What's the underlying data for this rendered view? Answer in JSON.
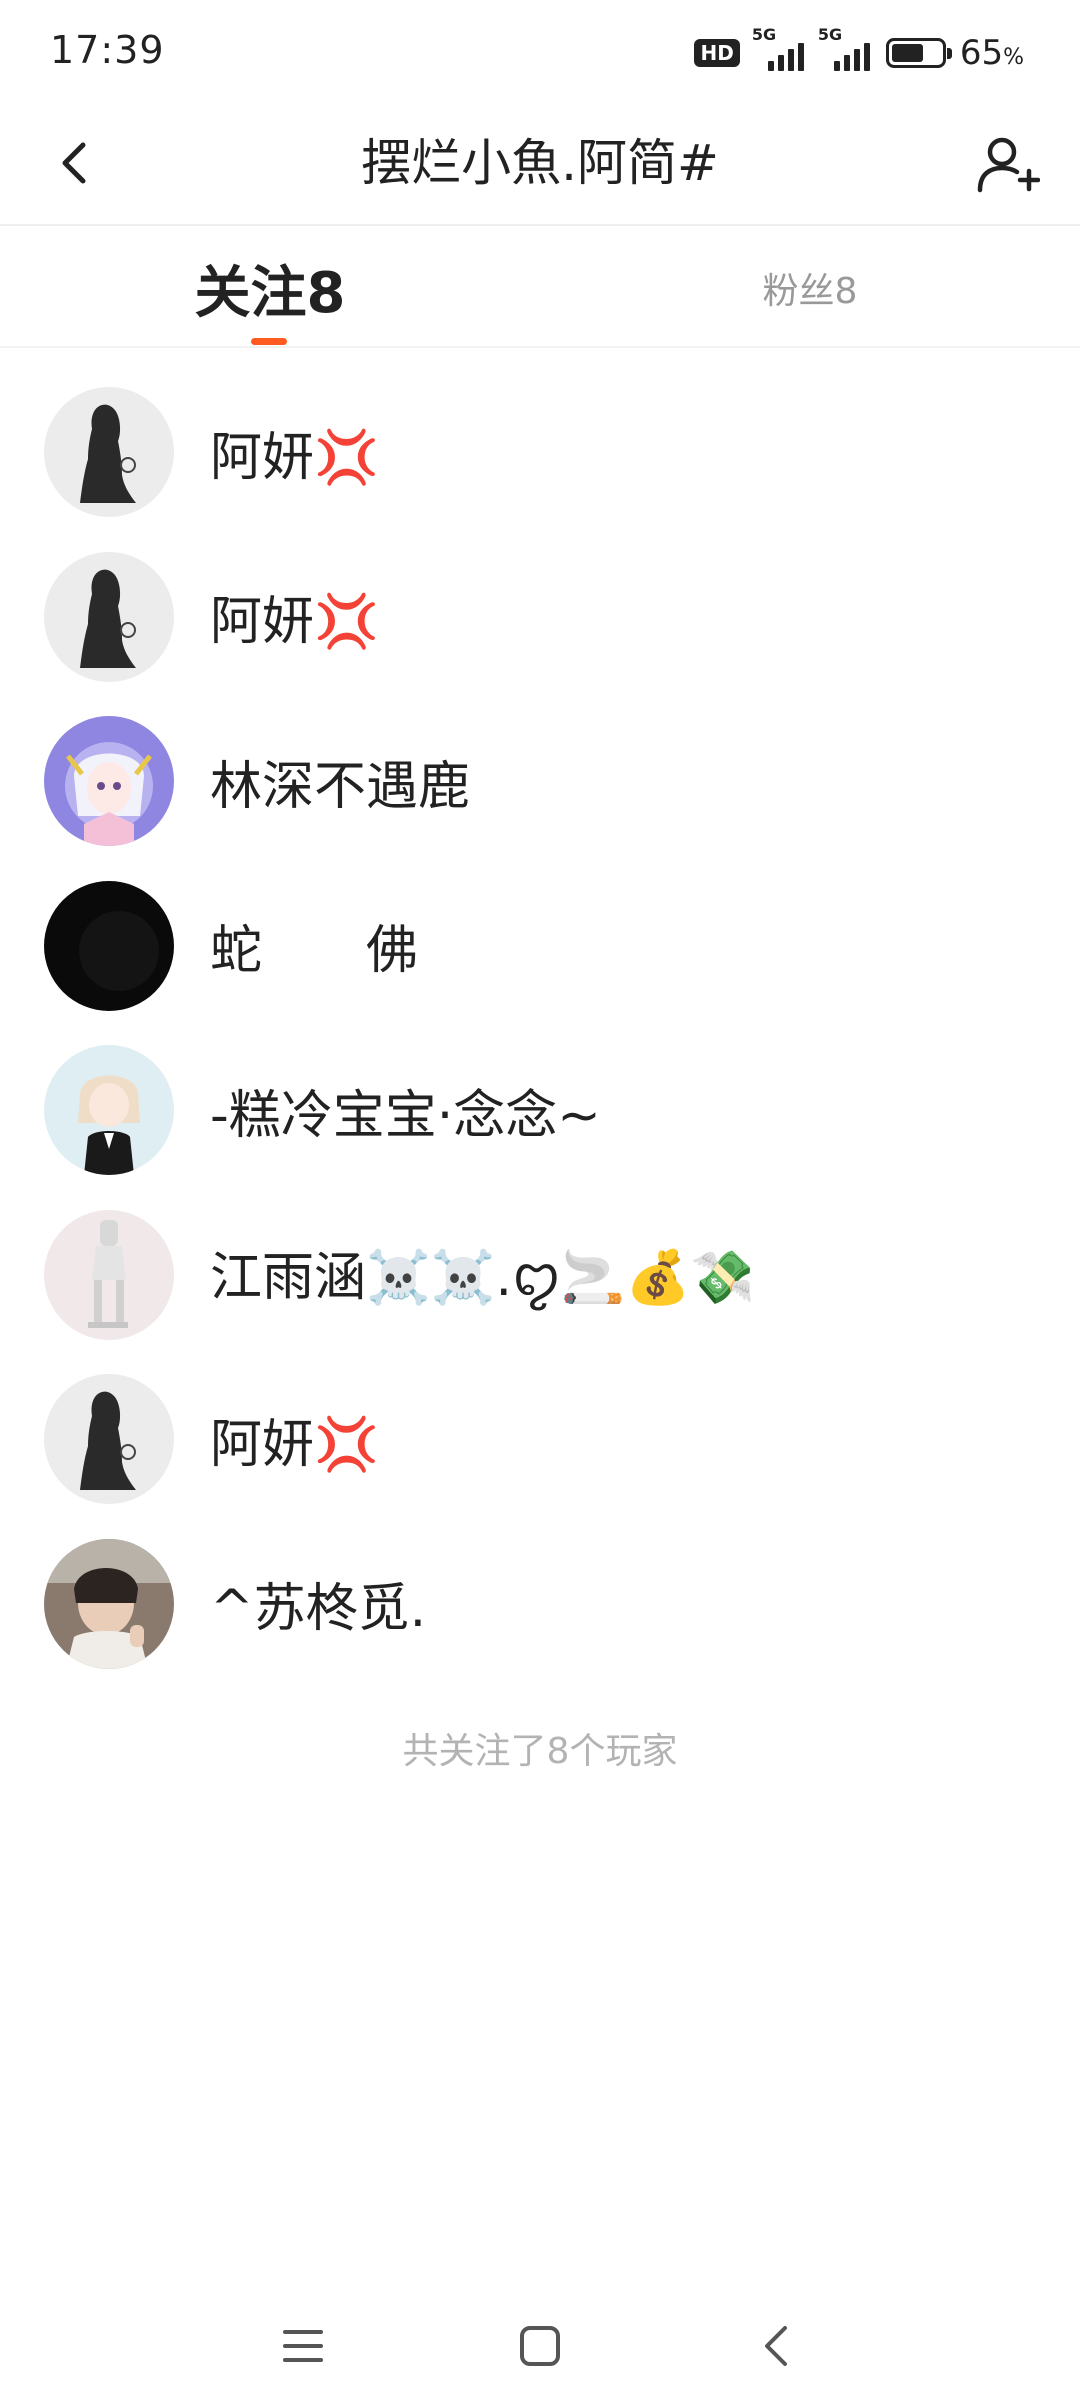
{
  "status_bar": {
    "time": "17:39",
    "hd_label": "HD",
    "signal_1_label": "5G",
    "signal_2_label": "5G",
    "battery_percent": 65,
    "battery_text": "65",
    "battery_unit": "%"
  },
  "header": {
    "title": "摆烂小魚.阿简#",
    "back_icon": "chevron-left-icon",
    "add_user_icon": "add-user-icon"
  },
  "tabs": [
    {
      "label": "关注8",
      "active": true
    },
    {
      "label": "粉丝8",
      "active": false
    }
  ],
  "accent_color": "#ff5a1f",
  "following": [
    {
      "name": "阿妍💢",
      "avatar": "silhouette-avatar"
    },
    {
      "name": "阿妍💢",
      "avatar": "silhouette-avatar"
    },
    {
      "name": "林深不遇鹿",
      "avatar": "anime-girl-avatar"
    },
    {
      "name": "蛇　　佛",
      "avatar": "black-avatar"
    },
    {
      "name": "-糕冷宝宝·念念~",
      "avatar": "anime-suit-avatar"
    },
    {
      "name": "江雨涵☠️☠️.ꨄ🚬💰💸",
      "avatar": "figurine-avatar"
    },
    {
      "name": "阿妍💢",
      "avatar": "silhouette-avatar"
    },
    {
      "name": "^苏柊觅.",
      "avatar": "photo-avatar"
    }
  ],
  "footer_note": "共关注了8个玩家",
  "nav_bar": {
    "menu_icon": "menu-icon",
    "home_icon": "home-square-icon",
    "back_icon": "back-triangle-icon"
  }
}
